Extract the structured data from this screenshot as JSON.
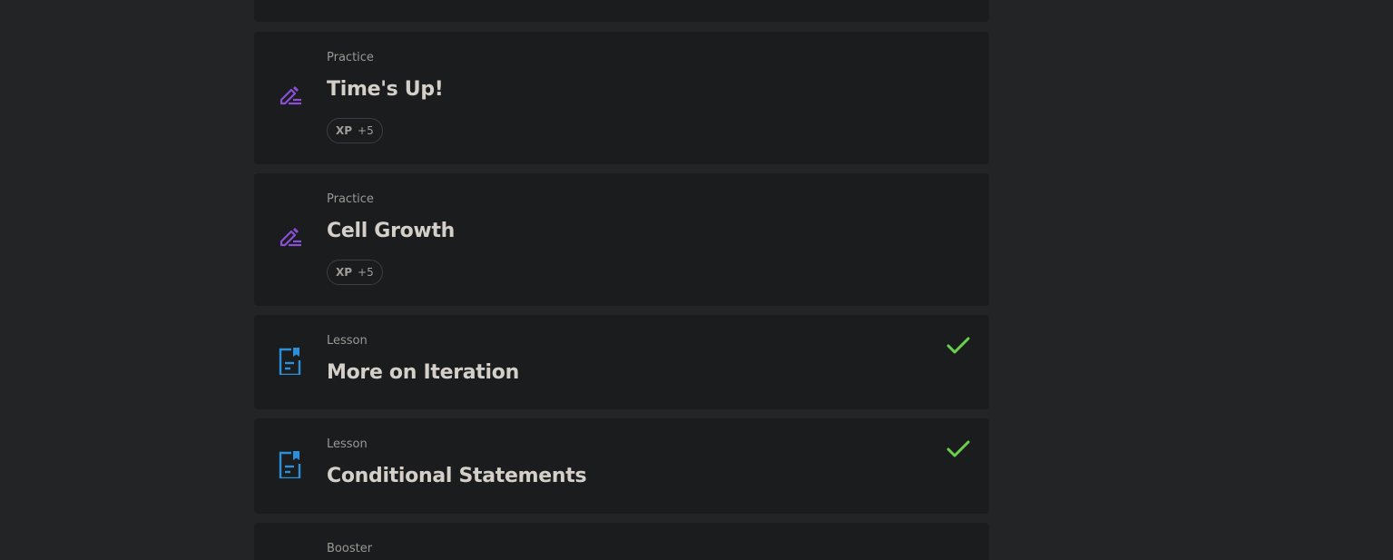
{
  "items": [
    {
      "kind": "",
      "title": ""
    },
    {
      "kind": "Practice",
      "title": "Time's Up!",
      "badge_label": "XP",
      "badge_value": "+5",
      "icon": "pencil-icon"
    },
    {
      "kind": "Practice",
      "title": "Cell Growth",
      "badge_label": "XP",
      "badge_value": "+5",
      "icon": "pencil-icon"
    },
    {
      "kind": "Lesson",
      "title": "More on Iteration",
      "icon": "document-bookmark-icon",
      "completed": true
    },
    {
      "kind": "Lesson",
      "title": "Conditional Statements",
      "icon": "document-bookmark-icon",
      "completed": true
    },
    {
      "kind": "Booster",
      "title": ""
    }
  ],
  "colors": {
    "page_bg": "#232426",
    "card_bg": "#1b1c1e",
    "practice_icon": "#8a4fd6",
    "lesson_icon": "#2b8fd9",
    "check": "#6cd14a"
  }
}
